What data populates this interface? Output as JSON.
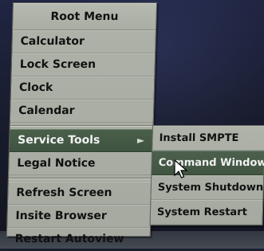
{
  "root_menu": {
    "title": "Root Menu",
    "items": [
      {
        "label": "Calculator"
      },
      {
        "label": "Lock Screen"
      },
      {
        "label": "Clock"
      },
      {
        "label": "Calendar"
      },
      {
        "label": "Service Tools",
        "submenu_indicator": "►"
      },
      {
        "label": "Legal Notice"
      },
      {
        "label": "Refresh Screen"
      },
      {
        "label": "Insite Browser"
      },
      {
        "label": "Restart Autoview"
      }
    ]
  },
  "service_tools_menu": {
    "items": [
      {
        "label": "Install SMPTE"
      },
      {
        "label": "Command Window"
      },
      {
        "label": "System Shutdown"
      },
      {
        "label": "System Restart"
      }
    ]
  },
  "colors": {
    "menu_bg": "#aeb2a8",
    "active_bg": "#495f4a",
    "active_text": "#f2f2f2",
    "text": "#111111",
    "screen_bg": "#1b1e31"
  },
  "icons": {
    "submenu_arrow": "chevron-right-icon",
    "mouse_pointer": "mouse-pointer-icon"
  }
}
